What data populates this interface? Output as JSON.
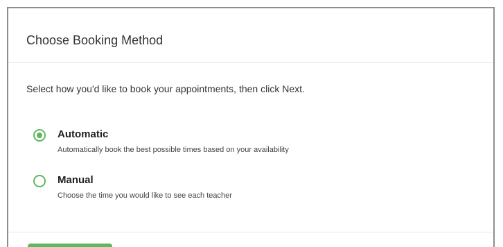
{
  "header": {
    "title": "Choose Booking Method"
  },
  "instruction": "Select how you'd like to book your appointments, then click Next.",
  "options": [
    {
      "label": "Automatic",
      "description": "Automatically book the best possible times based on your availability",
      "selected": true
    },
    {
      "label": "Manual",
      "description": "Choose the time you would like to see each teacher",
      "selected": false
    }
  ],
  "footer": {
    "next_label": ""
  },
  "colors": {
    "accent": "#5fb85f",
    "border": "#8e8e8e",
    "divider": "#e6e6e6",
    "text": "#333333"
  }
}
